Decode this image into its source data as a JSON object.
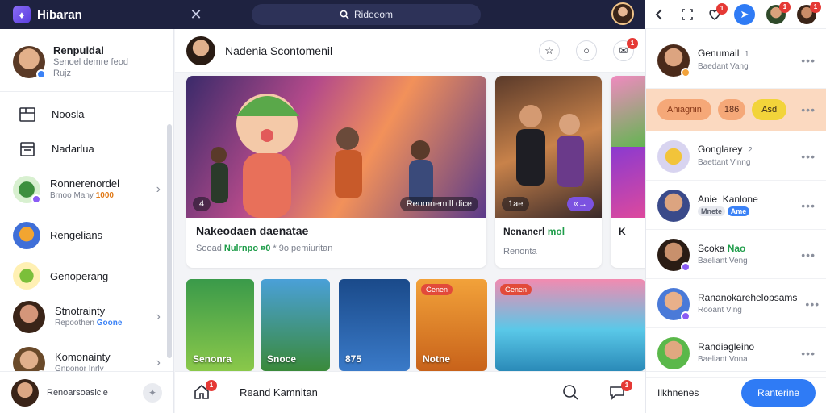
{
  "app": {
    "name": "Hibaran",
    "logo_glyph": "♦"
  },
  "search": {
    "text": "Rideeom"
  },
  "right_top": {
    "heart_badge": "1",
    "avatar_badge_1": "1",
    "avatar_badge_2": "1"
  },
  "sidebar": {
    "profile": {
      "name": "Renpuidal",
      "sub1": "Senoel demre feod",
      "sub2": "Rujz"
    },
    "nav": [
      {
        "label": "Noosla"
      },
      {
        "label": "Nadarlua"
      }
    ],
    "channels": [
      {
        "name": "Ronnerenordel",
        "sub": "Brnoo Many",
        "tag": "1000"
      },
      {
        "name": "Rengelians",
        "sub": ""
      },
      {
        "name": "Genoperang",
        "sub": ""
      },
      {
        "name": "Stnotrainty",
        "sub": "Repoothen",
        "tag": "Goone"
      },
      {
        "name": "Komonainty",
        "sub": "Gnponor Inrly"
      }
    ],
    "bottom_label": "Renoarsoasicle"
  },
  "main": {
    "header_title": "Nadenia Scontomenil",
    "header_badge": "1",
    "feature": {
      "overlay_left": "4",
      "overlay_right": "Renmnemill dice",
      "title": "Nakeodaen daenatae",
      "sub_prefix": "Sooad",
      "sub_green": "Nulrnpo ¤0",
      "sub_suffix": "* 9o pemiuritan"
    },
    "card2": {
      "overlay_left": "1ae",
      "overlay_right": "«→",
      "title": "Nenanerl",
      "title_suffix": "mol",
      "sub": "Renonta"
    },
    "card3": {
      "title": "K"
    },
    "thumbs": [
      {
        "label": "Senonra"
      },
      {
        "label": "Snoce"
      },
      {
        "label": "875"
      },
      {
        "label": "Notne",
        "chip": "Genen"
      },
      {
        "label": "",
        "chip": "Genen"
      }
    ],
    "footer_label": "Reand Kamnitan",
    "footer_badge_1": "1",
    "footer_badge_2": "1"
  },
  "right_panel": {
    "rows": [
      {
        "name": "Genumail",
        "extra": "1",
        "sub": "Baedant Vang"
      },
      {
        "name": "Gonglarey",
        "extra": "2",
        "sub": "Baettant Vinng"
      },
      {
        "name": "Anie",
        "extra": "Kanlone",
        "tag": "Mnete",
        "tag2": "Ame"
      },
      {
        "name": "Scoka",
        "tag": "Nao",
        "sub": "Baeliant Veng"
      },
      {
        "name": "Rananokarehelopsams",
        "sub": "Rooant Ving"
      },
      {
        "name": "Randiagleino",
        "sub": "Baeliant Vona"
      }
    ],
    "pills": [
      "Ahiagnin",
      "186",
      "Asd"
    ],
    "bottom_label": "Ilkhnenes",
    "bottom_button": "Ranterine"
  },
  "colors": {
    "topbar": "#1e2240",
    "accent_blue": "#2f7bf5",
    "highlight_row": "#fbd9c0",
    "badge_red": "#e53935"
  }
}
